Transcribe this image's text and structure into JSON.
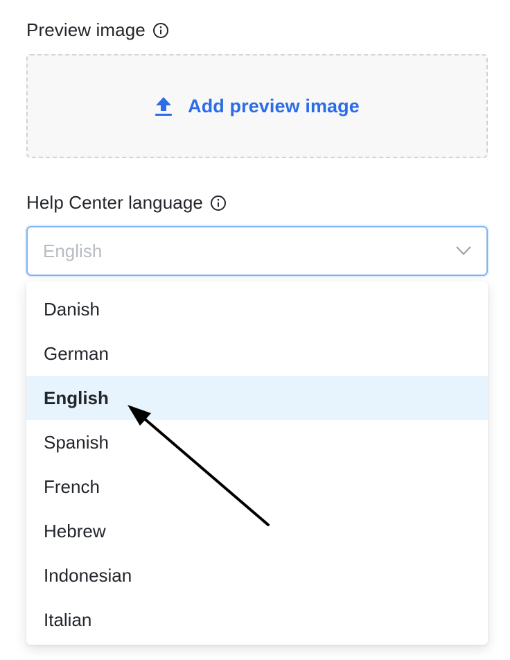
{
  "preview": {
    "label": "Preview image",
    "info_icon": "info-circle-icon",
    "add_label": "Add preview image",
    "upload_icon": "upload-icon"
  },
  "language": {
    "label": "Help Center language",
    "info_icon": "info-circle-icon",
    "selected_value": "English",
    "chevron_icon": "chevron-down-icon",
    "options": [
      {
        "label": "Danish",
        "selected": false
      },
      {
        "label": "German",
        "selected": false
      },
      {
        "label": "English",
        "selected": true
      },
      {
        "label": "Spanish",
        "selected": false
      },
      {
        "label": "French",
        "selected": false
      },
      {
        "label": "Hebrew",
        "selected": false
      },
      {
        "label": "Indonesian",
        "selected": false
      },
      {
        "label": "Italian",
        "selected": false
      }
    ]
  },
  "colors": {
    "accent": "#2c6ce6",
    "select_border": "#7fb4f2",
    "selected_option_bg": "#e8f4fd",
    "annotation_arrow": "#000000"
  }
}
